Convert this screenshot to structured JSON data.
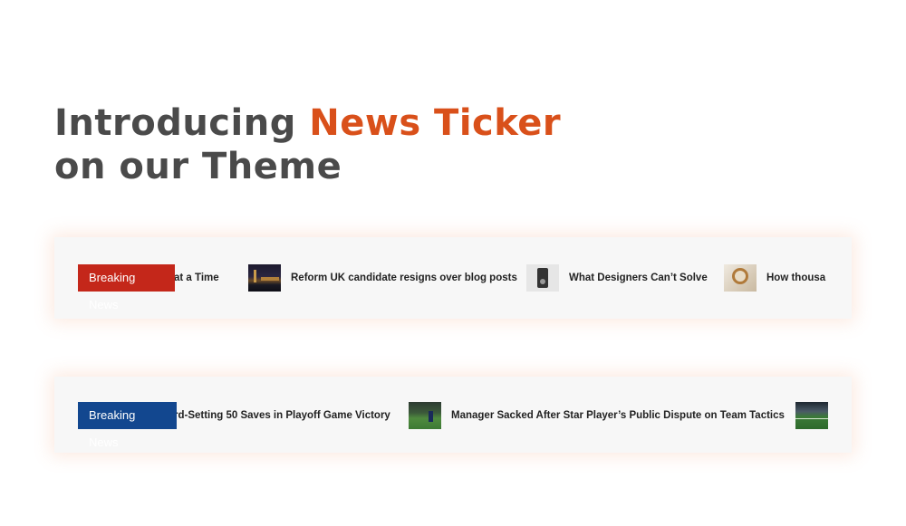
{
  "headline": {
    "prefix": "Introducing ",
    "accent": "News Ticker",
    "suffix": " on our Theme",
    "accent_color": "#d9501a"
  },
  "ticker_red": {
    "label": "Breaking News",
    "label_color": "#c4271a",
    "items": [
      {
        "text": "at a Time"
      },
      {
        "text": "Reform UK candidate resigns over blog posts",
        "thumb": "london-night-skyline-image"
      },
      {
        "text": "What Designers Can’t Solve",
        "thumb": "vintage-camera-image"
      },
      {
        "text": "How thousa",
        "thumb": "wristwatch-image"
      }
    ]
  },
  "ticker_blue": {
    "label": "Breaking News",
    "label_color": "#12478f",
    "items": [
      {
        "text": "rd-Setting 50 Saves in Playoff Game Victory"
      },
      {
        "text": "Manager Sacked After Star Player’s Public Dispute on Team Tactics",
        "thumb": "football-player-image"
      },
      {
        "text": "",
        "thumb": "stadium-pitch-image"
      }
    ]
  }
}
